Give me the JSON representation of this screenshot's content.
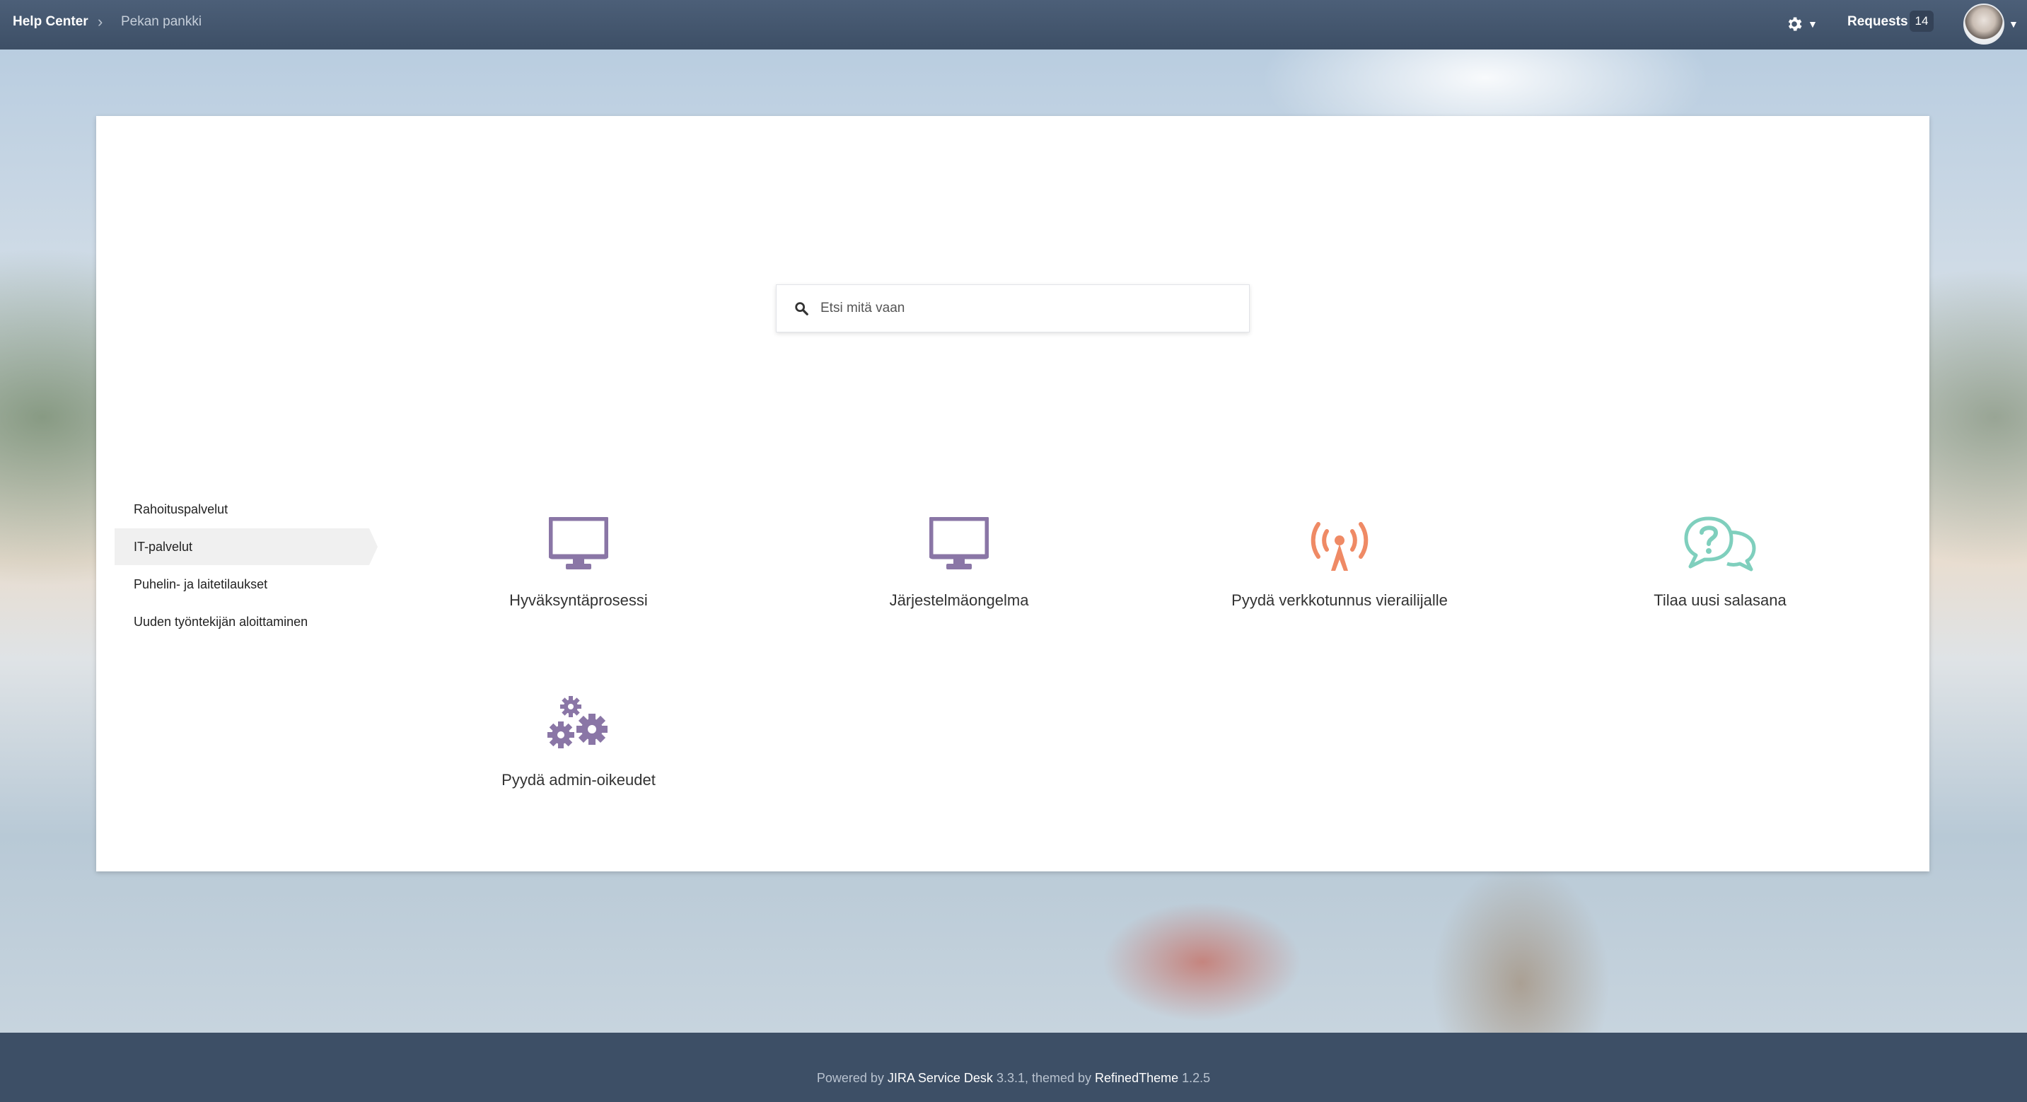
{
  "topbar": {
    "help_center": "Help Center",
    "breadcrumb_separator": "›",
    "project": "Pekan pankki",
    "requests_label": "Requests",
    "requests_count": "14"
  },
  "search": {
    "placeholder": "Etsi mitä vaan"
  },
  "sidebar": {
    "items": [
      {
        "label": "Rahoituspalvelut",
        "active": false
      },
      {
        "label": "IT-palvelut",
        "active": true
      },
      {
        "label": "Puhelin- ja laitetilaukset",
        "active": false
      },
      {
        "label": "Uuden työntekijän aloittaminen",
        "active": false
      }
    ]
  },
  "request_types": [
    {
      "label": "Hyväksyntäprosessi",
      "icon": "monitor-icon",
      "color": "#8a76a6"
    },
    {
      "label": "Järjestelmäongelma",
      "icon": "monitor-icon",
      "color": "#8a76a6"
    },
    {
      "label": "Pyydä verkkotunnus vierailijalle",
      "icon": "wifi-tower-icon",
      "color": "#ef8a65"
    },
    {
      "label": "Tilaa uusi salasana",
      "icon": "question-chat-icon",
      "color": "#7fcfbd"
    },
    {
      "label": "Pyydä admin-oikeudet",
      "icon": "gears-icon",
      "color": "#8a76a6"
    }
  ],
  "footer": {
    "prefix": "Powered by ",
    "product": "JIRA Service Desk",
    "middle": " 3.3.1, themed by ",
    "theme": "RefinedTheme",
    "version": " 1.2.5"
  }
}
